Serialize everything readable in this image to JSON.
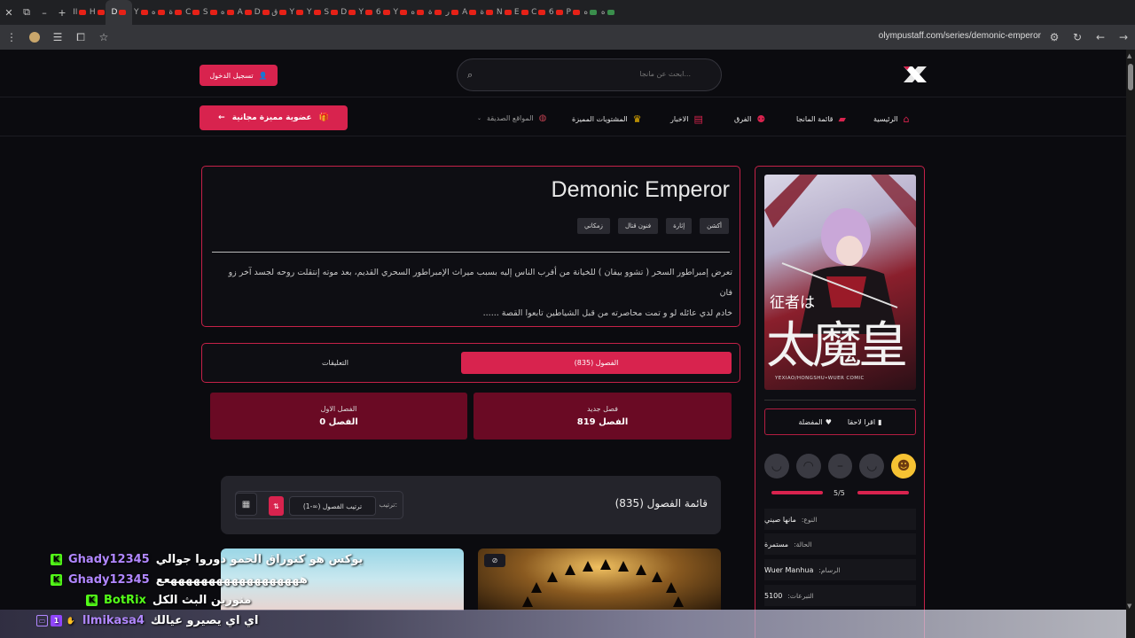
{
  "browser": {
    "tabs": [
      {
        "label": "II",
        "fav": "r"
      },
      {
        "label": "H",
        "fav": "r"
      },
      {
        "label": "D",
        "fav": "r",
        "active": true
      },
      {
        "label": "Y",
        "fav": "r"
      },
      {
        "label": "ه",
        "fav": "r"
      },
      {
        "label": "ة",
        "fav": "r"
      },
      {
        "label": "C",
        "fav": "r"
      },
      {
        "label": "S",
        "fav": "r"
      },
      {
        "label": "ه",
        "fav": "r"
      },
      {
        "label": "A",
        "fav": "r"
      },
      {
        "label": "D",
        "fav": "r"
      },
      {
        "label": "ق",
        "fav": "r"
      },
      {
        "label": "Y",
        "fav": "r"
      },
      {
        "label": "Y",
        "fav": "r"
      },
      {
        "label": "S",
        "fav": "r"
      },
      {
        "label": "D",
        "fav": "r"
      },
      {
        "label": "Y",
        "fav": "r"
      },
      {
        "label": "6",
        "fav": "r"
      },
      {
        "label": "Y",
        "fav": "r"
      },
      {
        "label": "ه",
        "fav": "r"
      },
      {
        "label": "ة",
        "fav": "r"
      },
      {
        "label": "ر",
        "fav": "r"
      },
      {
        "label": "A",
        "fav": "r"
      },
      {
        "label": "ة",
        "fav": "r"
      },
      {
        "label": "N",
        "fav": "r"
      },
      {
        "label": "E",
        "fav": "r"
      },
      {
        "label": "C",
        "fav": "r"
      },
      {
        "label": "6",
        "fav": "r"
      },
      {
        "label": "P",
        "fav": "r"
      },
      {
        "label": "ه",
        "fav": "g"
      },
      {
        "label": "ه",
        "fav": "g"
      }
    ],
    "url": "olympustaff.com/series/demonic-emperor"
  },
  "header": {
    "search_placeholder": "ابحث عن مانجا...",
    "login_label": "تسجيل الدخول"
  },
  "nav": {
    "items": [
      {
        "label": "الرئيسية",
        "icon": "home-icon"
      },
      {
        "label": "قائمة المانجا",
        "icon": "book-icon"
      },
      {
        "label": "الفرق",
        "icon": "users-icon"
      },
      {
        "label": "الاخبار",
        "icon": "news-icon"
      },
      {
        "label": "المشتويات المميزة",
        "icon": "crown-icon"
      },
      {
        "label": "المواقع الصديقة",
        "icon": "globe-icon"
      }
    ],
    "premium_label": "عضوية مميزة مجانية"
  },
  "series": {
    "title": "Demonic Emperor",
    "genres": [
      "أكشن",
      "إثارة",
      "فنون قتال",
      "زمكاني"
    ],
    "description_line1": "تعرض إمبراطور السحر ( تشوو بيفان ) للخيانة من أقرب الناس إليه بسبب ميراث الإمبراطور السحري القديم، بعد موته إنتقلت روحه لجسد آخر زو فان",
    "description_line2": "خادم لدي عائله لو و تمت محاصرته من قبل الشياطين تابعوا القصة ......"
  },
  "tabs": {
    "chapters_label": "الفصول (835)",
    "comments_label": "التعليقات"
  },
  "chapter_cards": {
    "new_label": "فصل جديد",
    "new_value": "الفصل 819",
    "first_label": "الفصل الاول",
    "first_value": "الفصل 0"
  },
  "chapter_list": {
    "title": "قائمة الفصول (835)",
    "sort_label": "ترتيب:",
    "sort_value": "ترتيب الفصول (∞-1)"
  },
  "sidebar": {
    "cover_title_small": "征者は",
    "cover_title_big": "太魔皇",
    "cover_credit": "YEXIAO/HONGSHU•WUER COMIC",
    "read_later": "اقرا لاحقا",
    "favorite": "المفضلة",
    "rating": "5/5",
    "info": [
      {
        "key": "النوع:",
        "value": "مانها صيني"
      },
      {
        "key": "الحالة:",
        "value": "مستمرة"
      },
      {
        "key": "الرسام:",
        "value": "Wuer Manhua"
      },
      {
        "key": "التبرعات:",
        "value": "5100"
      }
    ]
  },
  "chat": [
    {
      "platform": "kick",
      "user": "Ghady12345",
      "message": "يوكس هو كنوراق الحمو دوروا جوالي"
    },
    {
      "platform": "kick",
      "user": "Ghady12345",
      "message": "ههههههههههههههههههعع"
    },
    {
      "platform": "kick",
      "user": "BotRix",
      "message": "منورين البث الكل"
    },
    {
      "platform": "twitch",
      "user": "llmikasa4",
      "message": "اي اي يصيرو عيالك"
    }
  ],
  "colors": {
    "accent": "#d8234e",
    "card": "#6a0a24",
    "kick": "#53fc18",
    "twitch": "#b187ff"
  }
}
